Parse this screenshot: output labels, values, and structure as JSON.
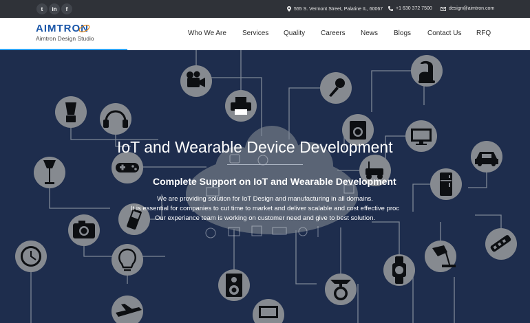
{
  "topbar": {
    "social": {
      "twitter": "t",
      "linkedin": "in",
      "facebook": "f"
    },
    "address": "555 S. Vermont Street, Palatine IL, 60067",
    "phone": "+1 630 372 7500",
    "email": "design@aimtron.com"
  },
  "logo": {
    "name": "AIMTRON",
    "tagline": "Aimtron Design Studio",
    "brand_color": "#1a56a8"
  },
  "nav": {
    "items": [
      "Who We Are",
      "Services",
      "Quality",
      "Careers",
      "News",
      "Blogs",
      "Contact Us",
      "RFQ"
    ]
  },
  "hero": {
    "title": "IoT and Wearable Device Development",
    "subtitle": "Complete Support on IoT and Wearable Development",
    "lines": [
      "We are providing solution for IoT Design and manufacturing in all domains.",
      "It is essential for companies to cut time to market and deliver scalable and cost effective proc",
      "Our experiance team is working on customer need and give to best solution."
    ],
    "background_color": "#1e2d4d"
  },
  "icons": [
    "video-camera-icon",
    "microphone-icon",
    "vacuum-cleaner-icon",
    "blender-icon",
    "headphones-icon",
    "printer-icon",
    "washing-machine-icon",
    "monitor-icon",
    "car-icon",
    "floor-lamp-icon",
    "gamepad-icon",
    "robot-toy-icon",
    "fridge-icon",
    "camera-icon",
    "mobile-phone-icon",
    "clock-icon",
    "light-bulb-icon",
    "speaker-icon",
    "watch-icon",
    "desk-lamp-icon",
    "tooth-brush-icon",
    "scale-icon",
    "airplane-icon",
    "laptop-icon"
  ]
}
